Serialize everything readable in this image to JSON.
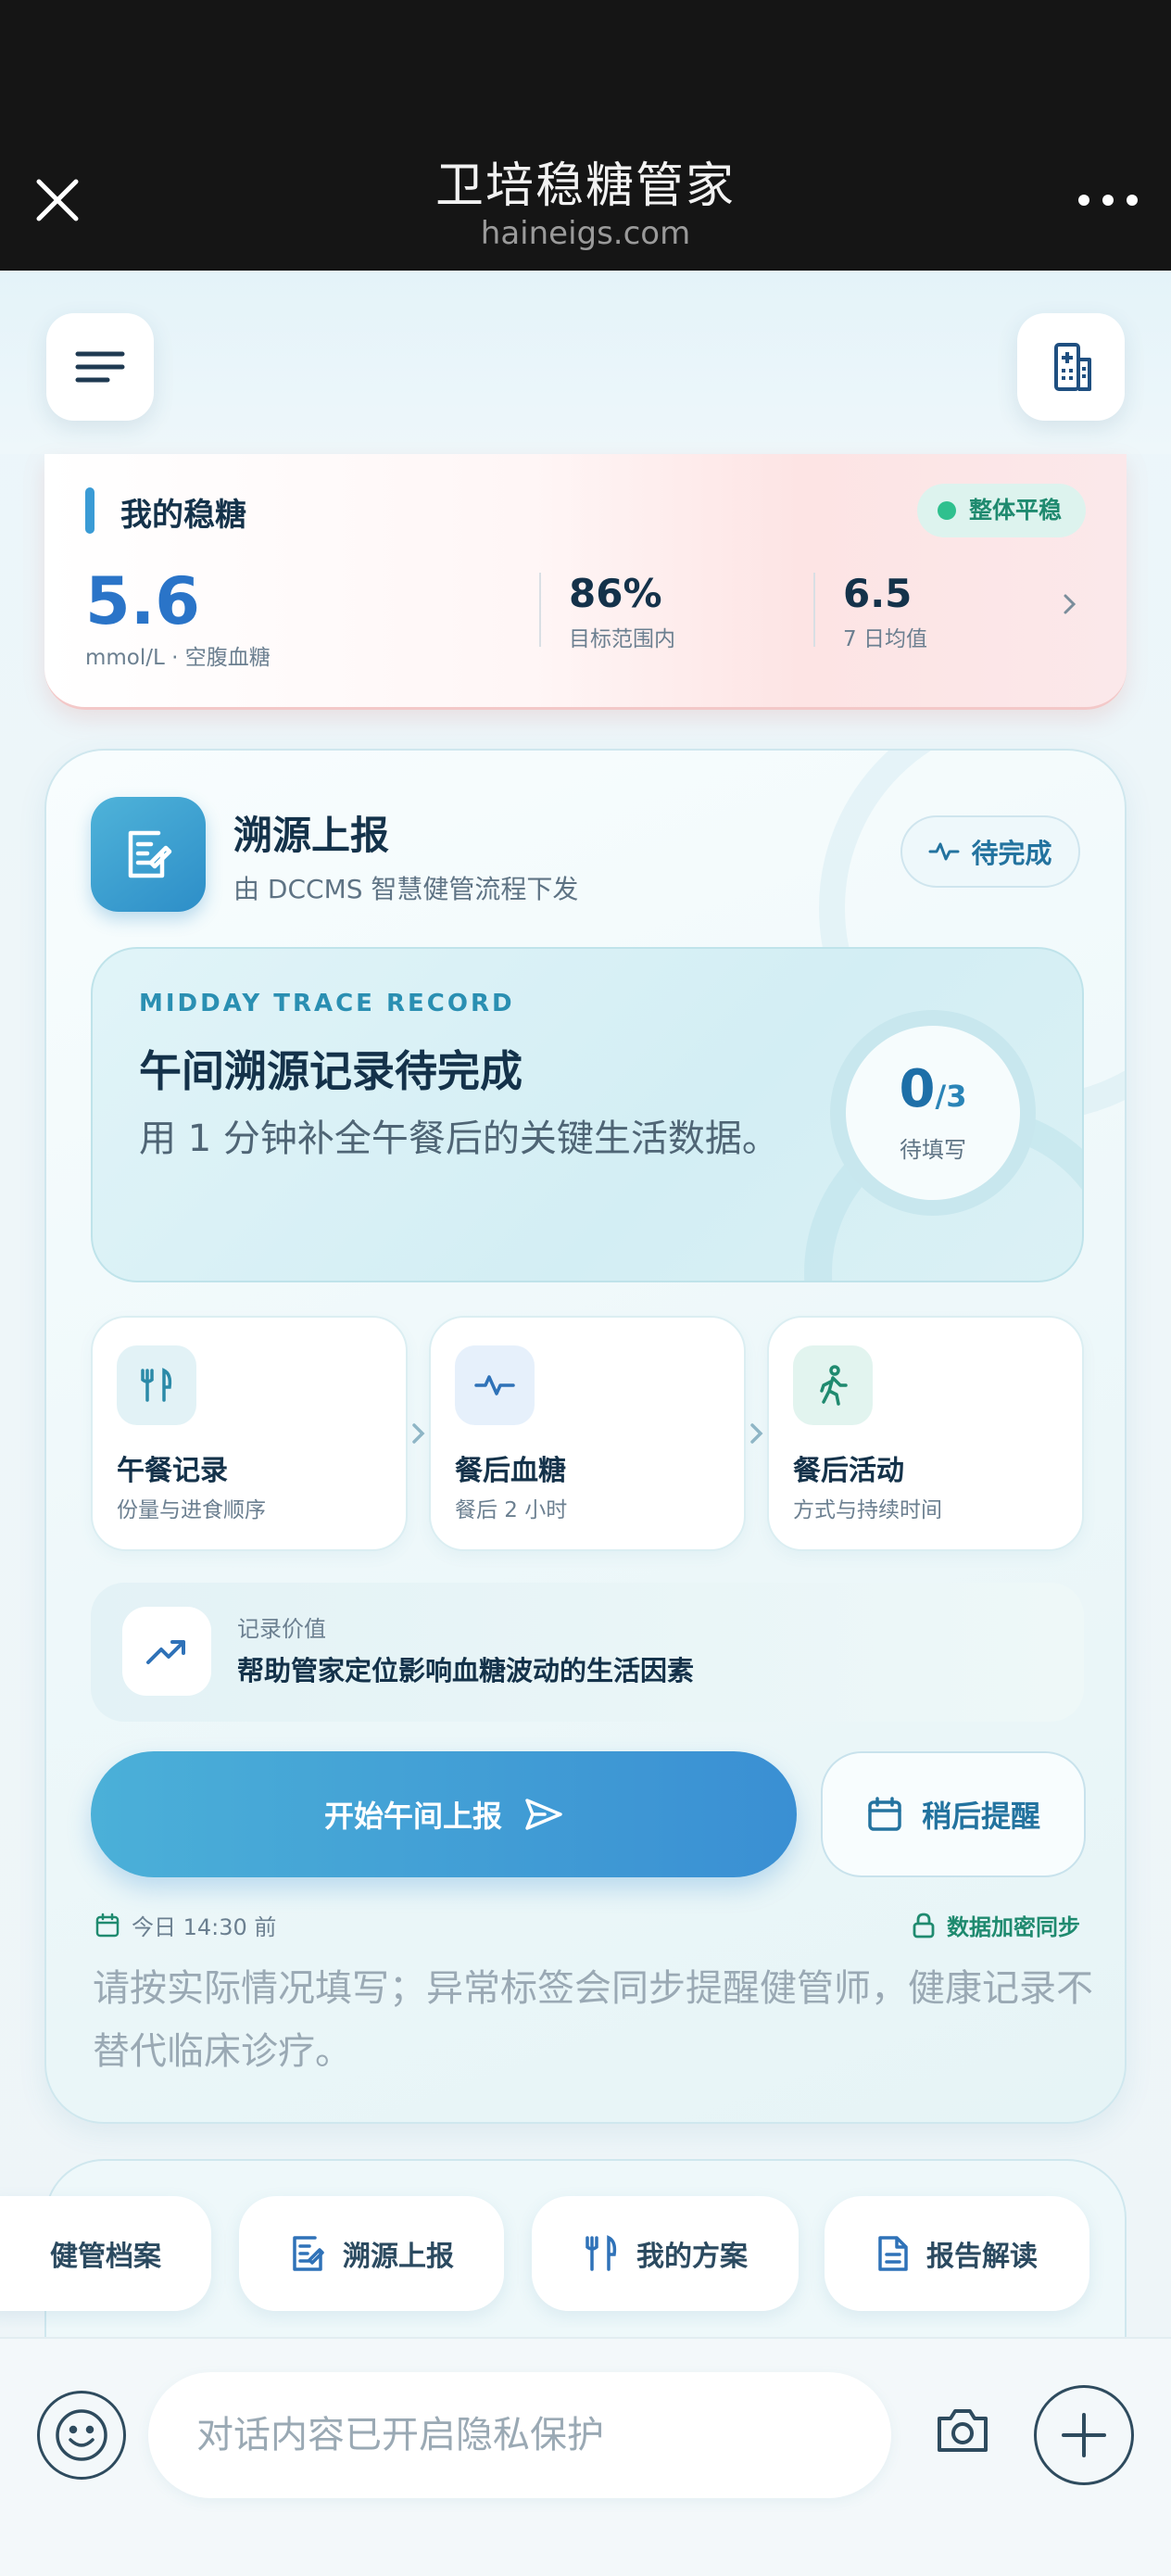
{
  "browser": {
    "title": "卫培稳糖管家",
    "domain": "haineigs.com"
  },
  "sugar_card": {
    "name": "我的稳糖",
    "status_badge": "整体平稳",
    "main_value": "5.6",
    "main_unit": "mmol/L · 空腹血糖",
    "stats": [
      {
        "value": "86%",
        "label": "目标范围内"
      },
      {
        "value": "6.5",
        "label": "7 日均值"
      }
    ]
  },
  "trace_card": {
    "title": "溯源上报",
    "subtitle": "由 DCCMS 智慧健管流程下发",
    "status_badge": "待完成",
    "panel": {
      "eyebrow": "MIDDAY TRACE RECORD",
      "heading": "午间溯源记录待完成",
      "description": "用 1 分钟补全午餐后的关键生活数据。",
      "progress_done": "0",
      "progress_total": "/3",
      "progress_label": "待填写"
    },
    "steps": [
      {
        "title": "午餐记录",
        "subtitle": "份量与进食顺序",
        "icon": "utensils-icon"
      },
      {
        "title": "餐后血糖",
        "subtitle": "餐后 2 小时",
        "icon": "pulse-icon"
      },
      {
        "title": "餐后活动",
        "subtitle": "方式与持续时间",
        "icon": "walking-icon"
      }
    ],
    "value_note": {
      "label": "记录价值",
      "text": "帮助管家定位影响血糖波动的生活因素"
    },
    "primary_button": "开始午间上报",
    "secondary_button": "稍后提醒",
    "due_time": "今日 14:30 前",
    "sync_note": "数据加密同步",
    "disclaimer": "请按实际情况填写；异常标签会同步提醒健管师，健康记录不替代临床诊疗。"
  },
  "quick_chips": [
    {
      "label": "健管档案",
      "icon": "none"
    },
    {
      "label": "溯源上报",
      "icon": "report-icon"
    },
    {
      "label": "我的方案",
      "icon": "utensils-icon"
    },
    {
      "label": "报告解读",
      "icon": "document-icon"
    }
  ],
  "input_bar": {
    "placeholder": "对话内容已开启隐私保护"
  },
  "colors": {
    "accent": "#3a8fd3",
    "success": "#1f8a6f",
    "text_dark": "#14324a"
  }
}
